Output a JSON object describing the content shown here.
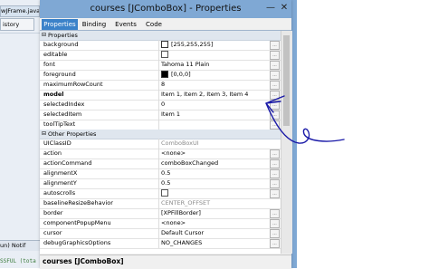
{
  "ide": {
    "file_tab": "wJFrame.java",
    "history_tab": "istory",
    "bottom_tabs": "un)  Notif",
    "console_text": "SSFUL (tota"
  },
  "dialog": {
    "title": "courses [JComboBox] - Properties",
    "minimize_glyph": "—",
    "close_glyph": "✕",
    "tabs": [
      {
        "label": "Properties"
      },
      {
        "label": "Binding"
      },
      {
        "label": "Events"
      },
      {
        "label": "Code"
      }
    ],
    "sections": {
      "properties": "Properties",
      "other": "Other Properties",
      "toggle": "⊟"
    },
    "properties": [
      {
        "name": "background",
        "value": "[255,255,255]"
      },
      {
        "name": "editable",
        "value": ""
      },
      {
        "name": "font",
        "value": "Tahoma 11 Plain"
      },
      {
        "name": "foreground",
        "value": "[0,0,0]"
      },
      {
        "name": "maximumRowCount",
        "value": "8"
      },
      {
        "name": "model",
        "value": "Item 1, Item 2, Item 3, Item 4"
      },
      {
        "name": "selectedIndex",
        "value": "0"
      },
      {
        "name": "selectedItem",
        "value": "Item 1"
      },
      {
        "name": "toolTipText",
        "value": ""
      }
    ],
    "other_properties": [
      {
        "name": "UIClassID",
        "value": "ComboBoxUI"
      },
      {
        "name": "action",
        "value": "<none>"
      },
      {
        "name": "actionCommand",
        "value": "comboBoxChanged"
      },
      {
        "name": "alignmentX",
        "value": "0.5"
      },
      {
        "name": "alignmentY",
        "value": "0.5"
      },
      {
        "name": "autoscrolls",
        "value": ""
      },
      {
        "name": "baselineResizeBehavior",
        "value": "CENTER_OFFSET"
      },
      {
        "name": "border",
        "value": "[XPFillBorder]"
      },
      {
        "name": "componentPopupMenu",
        "value": "<none>"
      },
      {
        "name": "cursor",
        "value": "Default Cursor"
      },
      {
        "name": "debugGraphicsOptions",
        "value": "NO_CHANGES"
      }
    ],
    "ellipsis_label": "...",
    "status_text": "courses [JComboBox]"
  },
  "colors": {
    "title_bar": "#7fa8d4",
    "active_tab": "#3b82c9",
    "annotation_ink": "#1a1aa8"
  }
}
